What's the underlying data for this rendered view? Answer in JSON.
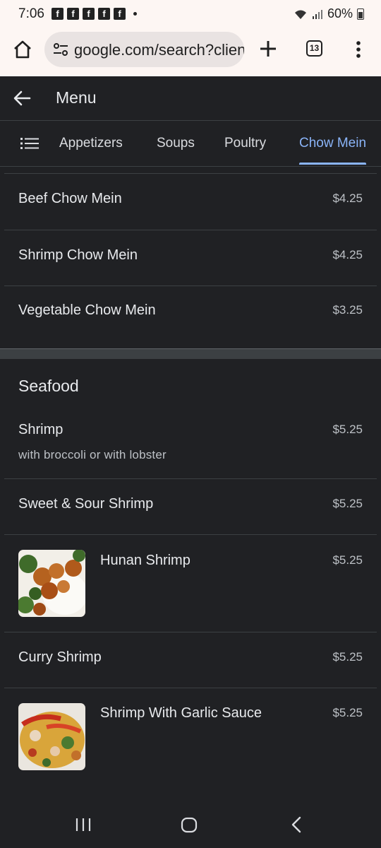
{
  "status_bar": {
    "time": "7:06",
    "notification_icons": [
      "facebook-icon",
      "facebook-icon",
      "facebook-icon",
      "facebook-icon",
      "facebook-icon"
    ],
    "battery": "60%"
  },
  "browser": {
    "url": "google.com/search?client",
    "tab_count": "13"
  },
  "app_bar": {
    "title": "Menu"
  },
  "category_tabs": [
    {
      "label": "Appetizers",
      "active": false
    },
    {
      "label": "Soups",
      "active": false
    },
    {
      "label": "Poultry",
      "active": false
    },
    {
      "label": "Chow Mein",
      "active": true
    }
  ],
  "chow_mein_items": [
    {
      "name": "Beef Chow Mein",
      "price": "$4.25"
    },
    {
      "name": "Shrimp Chow Mein",
      "price": "$4.25"
    },
    {
      "name": "Vegetable Chow Mein",
      "price": "$3.25"
    }
  ],
  "seafood": {
    "title": "Seafood",
    "items": [
      {
        "name": "Shrimp",
        "description": "with broccoli or with lobster",
        "price": "$5.25"
      },
      {
        "name": "Sweet & Sour Shrimp",
        "price": "$5.25"
      },
      {
        "name": "Hunan Shrimp",
        "price": "$5.25",
        "has_image": true
      },
      {
        "name": "Curry Shrimp",
        "price": "$5.25"
      },
      {
        "name": "Shrimp With Garlic Sauce",
        "price": "$5.25",
        "has_image": true
      }
    ]
  },
  "colors": {
    "background": "#202124",
    "accent": "#8ab4f8",
    "chrome_toolbar": "#fdf6f3"
  }
}
